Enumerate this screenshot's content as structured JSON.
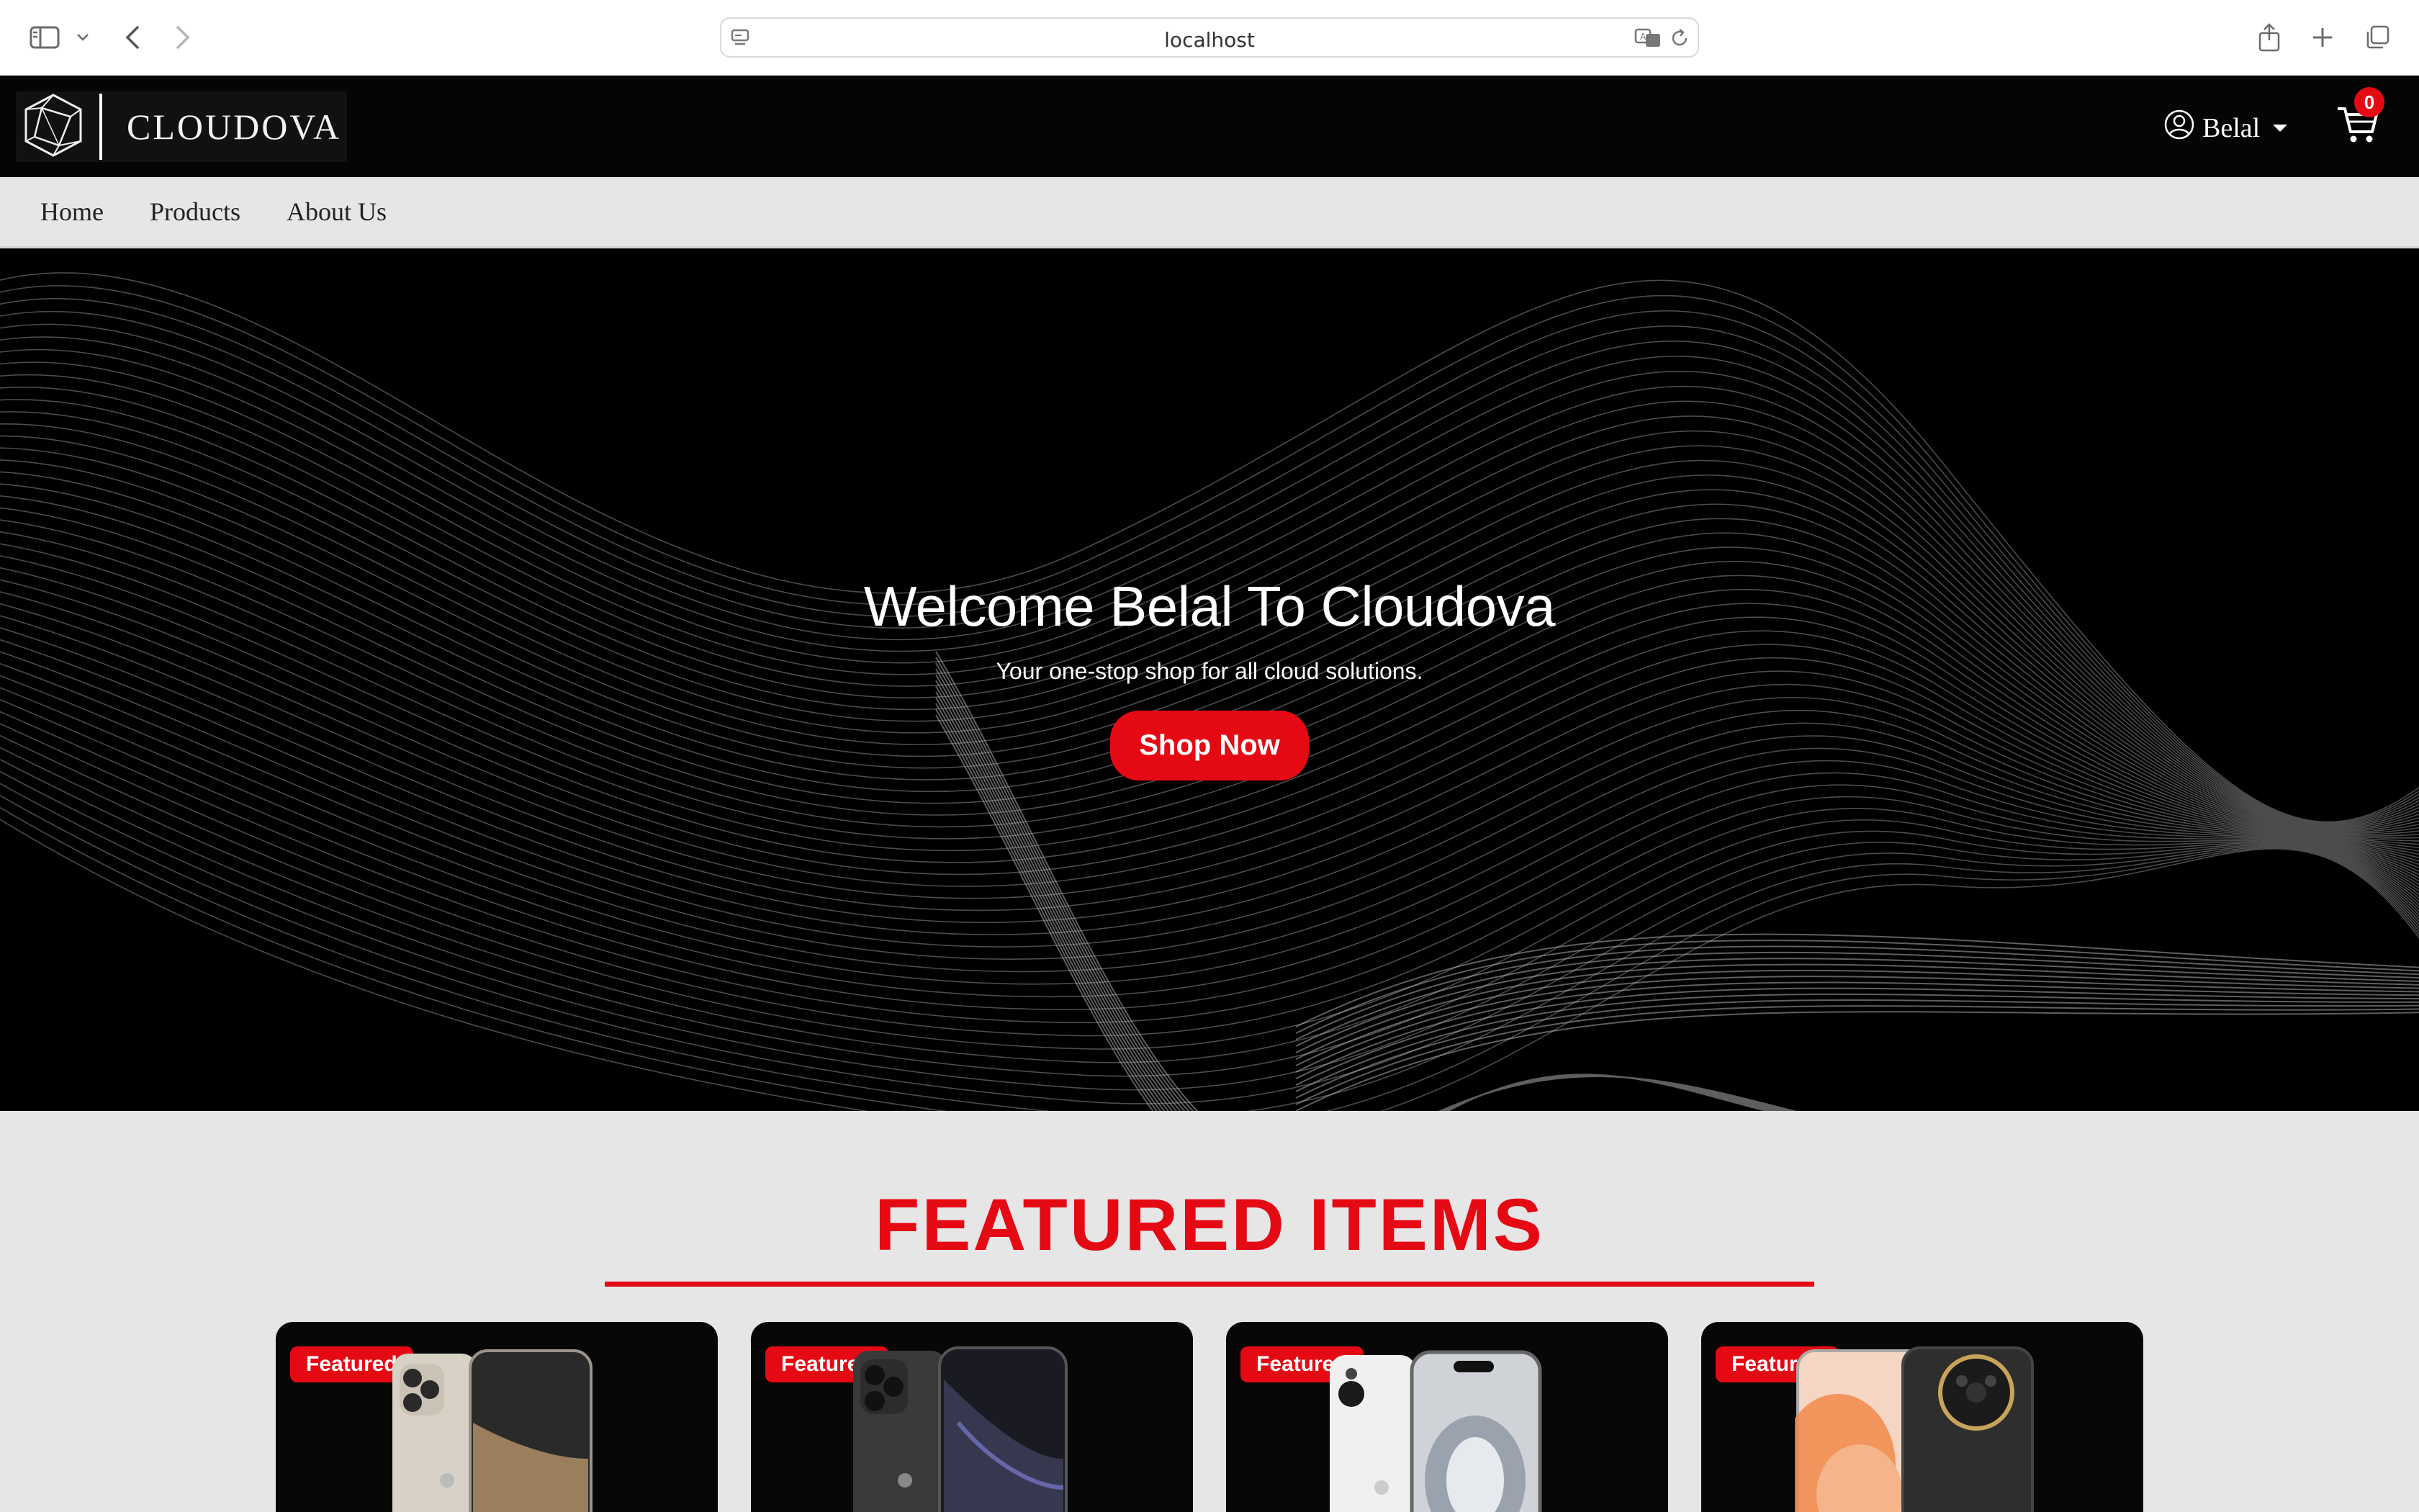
{
  "browser": {
    "url": "localhost",
    "icons": [
      "sidebar-icon",
      "chevron-down-icon",
      "back-icon",
      "forward-icon",
      "page-icon",
      "translate-icon",
      "reload-icon",
      "share-icon",
      "new-tab-icon",
      "tabs-overview-icon"
    ]
  },
  "header": {
    "brand": "CLOUDOVA",
    "user_name": "Belal",
    "cart_count": "0"
  },
  "nav": {
    "items": [
      "Home",
      "Products",
      "About Us"
    ]
  },
  "hero": {
    "title": "Welcome Belal To Cloudova",
    "subtitle": "Your one-stop shop for all cloud solutions.",
    "cta": "Shop Now"
  },
  "featured": {
    "title": "FEATURED ITEMS",
    "badge": "Featured",
    "cards": [
      {
        "badge": "Featured"
      },
      {
        "badge": "Featured"
      },
      {
        "badge": "Featured"
      },
      {
        "badge": "Featured"
      }
    ]
  },
  "colors": {
    "accent": "#e50914",
    "header_bg": "#050505",
    "page_bg": "#e6e6e6"
  }
}
